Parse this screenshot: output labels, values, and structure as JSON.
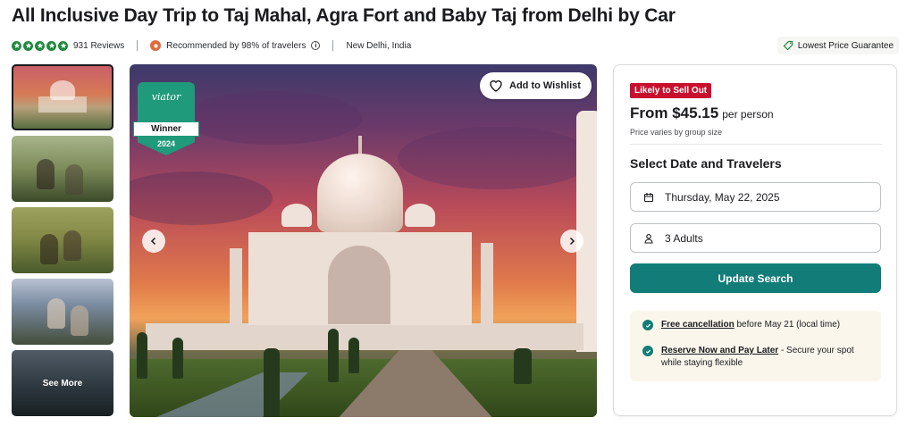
{
  "title": "All Inclusive Day Trip to Taj Mahal, Agra Fort and Baby Taj from Delhi by Car",
  "meta": {
    "rating_stars": 5,
    "reviews": "931 Reviews",
    "recommended": "Recommended by 98% of travelers",
    "location": "New Delhi, India",
    "guarantee": "Lowest Price Guarantee"
  },
  "gallery": {
    "see_more": "See More",
    "wishlist": "Add to Wishlist",
    "badge": {
      "brand": "viator",
      "label": "Winner",
      "year": "2024"
    }
  },
  "booking": {
    "badge": "Likely to Sell Out",
    "price": "From $45.15",
    "per": "per person",
    "price_note": "Price varies by group size",
    "section_title": "Select Date and Travelers",
    "date": "Thursday, May 22, 2025",
    "travelers": "3 Adults",
    "update_button": "Update Search",
    "perks": [
      {
        "link": "Free cancellation",
        "text": " before May 21 (local time)"
      },
      {
        "link": "Reserve Now and Pay Later",
        "text": " - Secure your spot while staying flexible"
      }
    ]
  },
  "colors": {
    "accent": "#127c78",
    "star": "#1f8a3d",
    "sellout": "#c8102e"
  }
}
